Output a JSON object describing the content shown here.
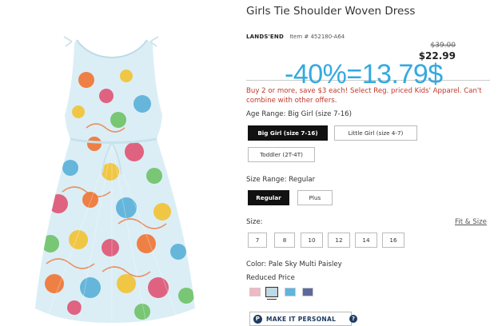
{
  "product": {
    "title": "Girls Tie Shoulder Woven Dress",
    "brand": "LANDS'END",
    "item_number": "Item # 452180-A64",
    "price_original": "$39.00",
    "price_sale": "$22.99"
  },
  "annotation": {
    "text": "-40%=13.79$",
    "color": "#33a9e0"
  },
  "promo": {
    "text": "Buy 2 or more, save $3 each! Select Reg. priced Kids' Apparel. Can't combine with other offers.",
    "color": "#c0392b"
  },
  "age_range": {
    "label": "Age Range: Big Girl (size 7-16)",
    "options": [
      "Big Girl (size 7-16)",
      "Little Girl (size 4-7)",
      "Toddler (2T-4T)"
    ],
    "selected": "Big Girl (size 7-16)"
  },
  "size_range": {
    "label": "Size Range: Regular",
    "options": [
      "Regular",
      "Plus"
    ],
    "selected": "Regular"
  },
  "size": {
    "label": "Size:",
    "fit_link": "Fit & Size",
    "options": [
      "7",
      "8",
      "10",
      "12",
      "14",
      "16"
    ]
  },
  "color": {
    "label": "Color: Pale Sky Multi Paisley",
    "reduced_label": "Reduced Price",
    "swatches": [
      {
        "name": "pink-floral-swatch",
        "color": "#f3b6c4"
      },
      {
        "name": "pale-sky-paisley-swatch",
        "color": "#b9dcec"
      },
      {
        "name": "blue-pink-swatch",
        "color": "#5db5e0"
      },
      {
        "name": "navy-pattern-swatch",
        "color": "#5c6a9a"
      }
    ],
    "selected": "pale-sky-paisley-swatch"
  },
  "personalize": {
    "label": "MAKE IT PERSONAL",
    "icon_letter": "P",
    "help_glyph": "?"
  }
}
